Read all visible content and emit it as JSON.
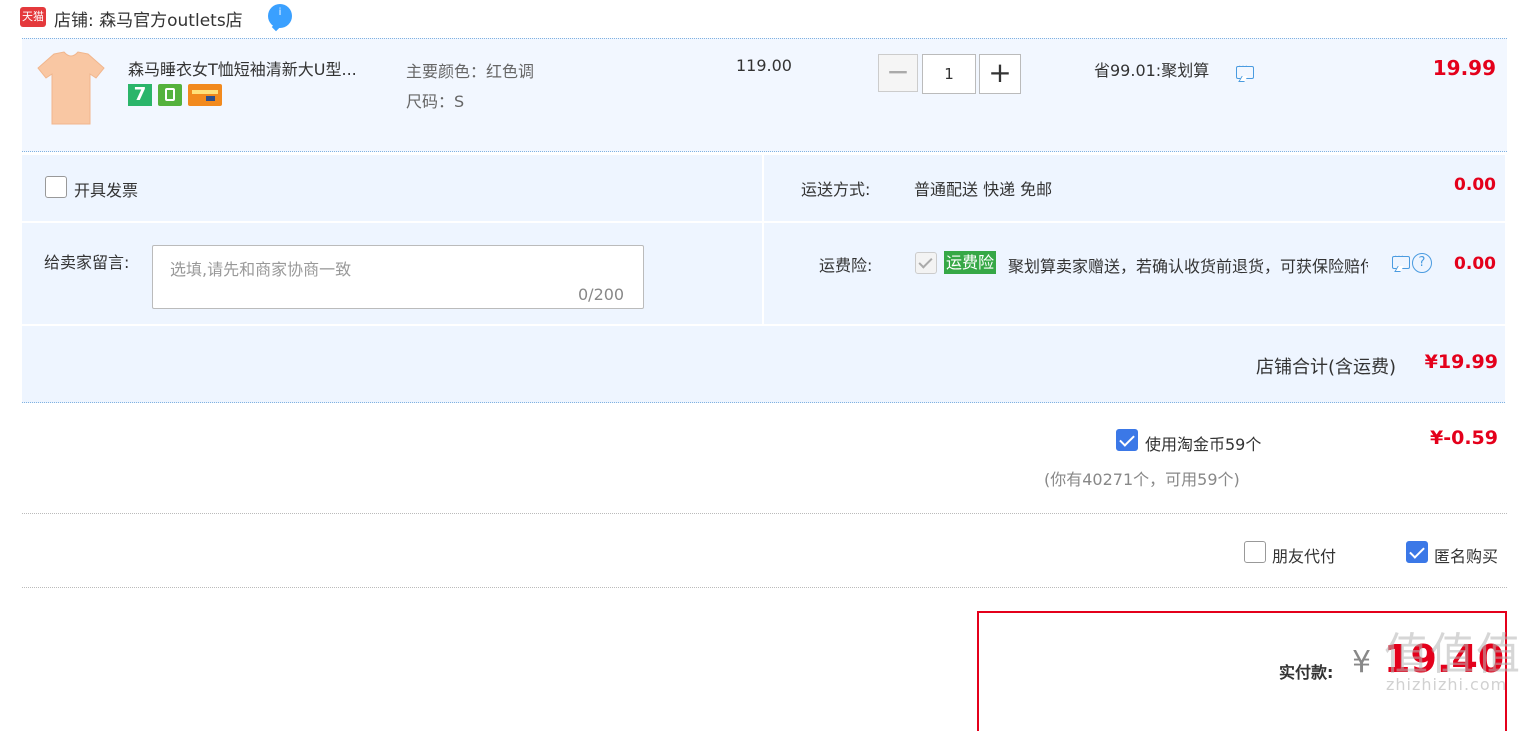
{
  "shop": {
    "badge": "天猫",
    "name": "店铺: 森马官方outlets店",
    "ww_badge": "i"
  },
  "item": {
    "title": "森马睡衣女T恤短袖清新大U型...",
    "service_badge_7": "7",
    "sku_color": "主要颜色：红色调",
    "sku_size": "尺码：S",
    "price": "119.00",
    "qty_minus": "−",
    "qty": "1",
    "qty_plus": "+",
    "promo": "省99.01:聚划算",
    "subtotal": "19.99",
    "thumb_color": "#f9c7a3"
  },
  "options": {
    "invoice_label": "开具发票",
    "message_label": "给卖家留言:",
    "message_placeholder": "选填,请先和商家协商一致",
    "message_count": "0/200",
    "shipping_label": "运送方式:",
    "shipping_value": "普通配送 快递 免邮",
    "shipping_price": "0.00",
    "insurance_label": "运费险:",
    "insurance_badge": "运费险",
    "insurance_text": "聚划算卖家赠送，若确认收货前退货，可获保险赔付",
    "insurance_help": "?",
    "insurance_price": "0.00",
    "shop_total_label": "店铺合计(含运费)",
    "shop_total_value": "¥19.99"
  },
  "coins": {
    "label": "使用淘金币59个",
    "sub": "(你有40271个，可用59个)",
    "value": "¥-0.59"
  },
  "purchase_options": {
    "friend_pay": "朋友代付",
    "anonymous": "匿名购买"
  },
  "payment": {
    "label": "实付款:",
    "yen": "¥",
    "amount": "19.40"
  },
  "watermark": {
    "main": "值值值",
    "sub": "zhizhizhi.com"
  },
  "colors": {
    "accent_red": "#e4001b",
    "panel_blue": "#eef5ff",
    "checkbox_blue": "#3b78e7",
    "insurance_green": "#36a846"
  }
}
